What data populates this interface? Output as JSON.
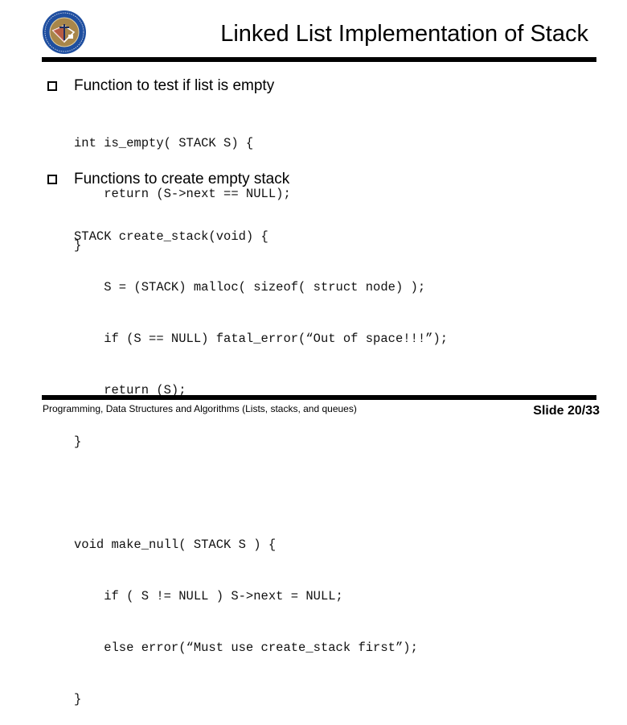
{
  "header": {
    "logo_icon": "university-seal-icon",
    "title": "Linked List Implementation of Stack"
  },
  "sections": [
    {
      "bullet_icon": "hollow-square-bullet-icon",
      "heading": "Function to test if list is empty",
      "code": [
        "int is_empty( STACK S) {",
        "    return (S->next == NULL);",
        "}"
      ]
    },
    {
      "bullet_icon": "hollow-square-bullet-icon",
      "heading": "Functions to create empty stack",
      "code": [
        "STACK create_stack(void) {",
        "    S = (STACK) malloc( sizeof( struct node) );",
        "    if (S == NULL) fatal_error(“Out of space!!!”);",
        "    return (S);",
        "}",
        "",
        "void make_null( STACK S ) {",
        "    if ( S != NULL ) S->next = NULL;",
        "    else error(“Must use create_stack first”);",
        "}"
      ]
    }
  ],
  "footer": {
    "course": "Programming, Data Structures and Algorithms  (Lists, stacks, and queues)",
    "slide_number": "Slide 20/33"
  },
  "colors": {
    "text": "#000000",
    "background": "#ffffff",
    "seal_blue": "#1f4fa0",
    "seal_gold": "#a8864a"
  }
}
